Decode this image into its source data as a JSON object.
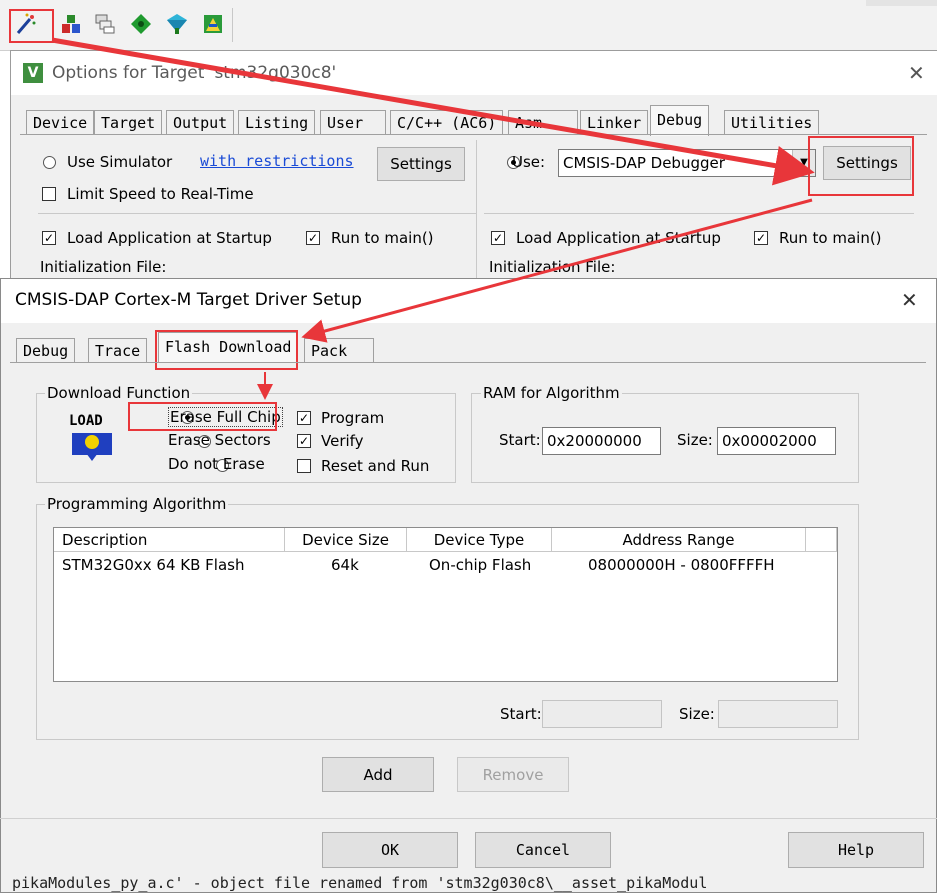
{
  "toolbar": {
    "icons": [
      "wand-icon",
      "load-icon",
      "copy-icon",
      "green-diamond-icon",
      "download-icon",
      "tools-icon"
    ]
  },
  "options_window": {
    "title": "Options for Target 'stm32g030c8'",
    "close": "✕",
    "tabs": [
      "Device",
      "Target",
      "Output",
      "Listing",
      "User",
      "C/C++ (AC6)",
      "Asm",
      "Linker",
      "Debug",
      "Utilities"
    ],
    "active_tab": "Debug",
    "left": {
      "use_simulator": "Use Simulator",
      "restrictions_link": "with restrictions",
      "settings": "Settings",
      "limit_speed": "Limit Speed to Real-Time",
      "load_app": "Load Application at Startup",
      "run_to_main": "Run to main()",
      "init_file": "Initialization File:"
    },
    "right": {
      "use_label": "Use:",
      "debugger": "CMSIS-DAP Debugger",
      "settings": "Settings",
      "load_app": "Load Application at Startup",
      "run_to_main": "Run to main()",
      "init_file": "Initialization File:"
    }
  },
  "setup_dialog": {
    "title": "CMSIS-DAP Cortex-M Target Driver Setup",
    "close": "✕",
    "tabs": [
      "Debug",
      "Trace",
      "Flash Download",
      "Pack"
    ],
    "active_tab": "Flash Download",
    "download_function": {
      "label": "Download Function",
      "load_icon_text": "LOAD",
      "erase_full_chip": "Erase Full Chip",
      "erase_sectors": "Erase Sectors",
      "do_not_erase": "Do not Erase",
      "program": "Program",
      "verify": "Verify",
      "reset_and_run": "Reset and Run"
    },
    "ram": {
      "label": "RAM for Algorithm",
      "start_label": "Start:",
      "start_value": "0x20000000",
      "size_label": "Size:",
      "size_value": "0x00002000"
    },
    "programming": {
      "label": "Programming Algorithm",
      "columns": [
        "Description",
        "Device Size",
        "Device Type",
        "Address Range"
      ],
      "rows": [
        [
          "STM32G0xx 64 KB Flash",
          "64k",
          "On-chip Flash",
          "08000000H - 0800FFFFH"
        ]
      ],
      "start_label": "Start:",
      "size_label": "Size:"
    },
    "add": "Add",
    "remove": "Remove",
    "ok": "OK",
    "cancel": "Cancel",
    "help": "Help"
  },
  "status_line": "pikaModules_py_a.c' - object file renamed from 'stm32g030c8\\__asset_pikaModul",
  "accent_color": "#e8363a"
}
